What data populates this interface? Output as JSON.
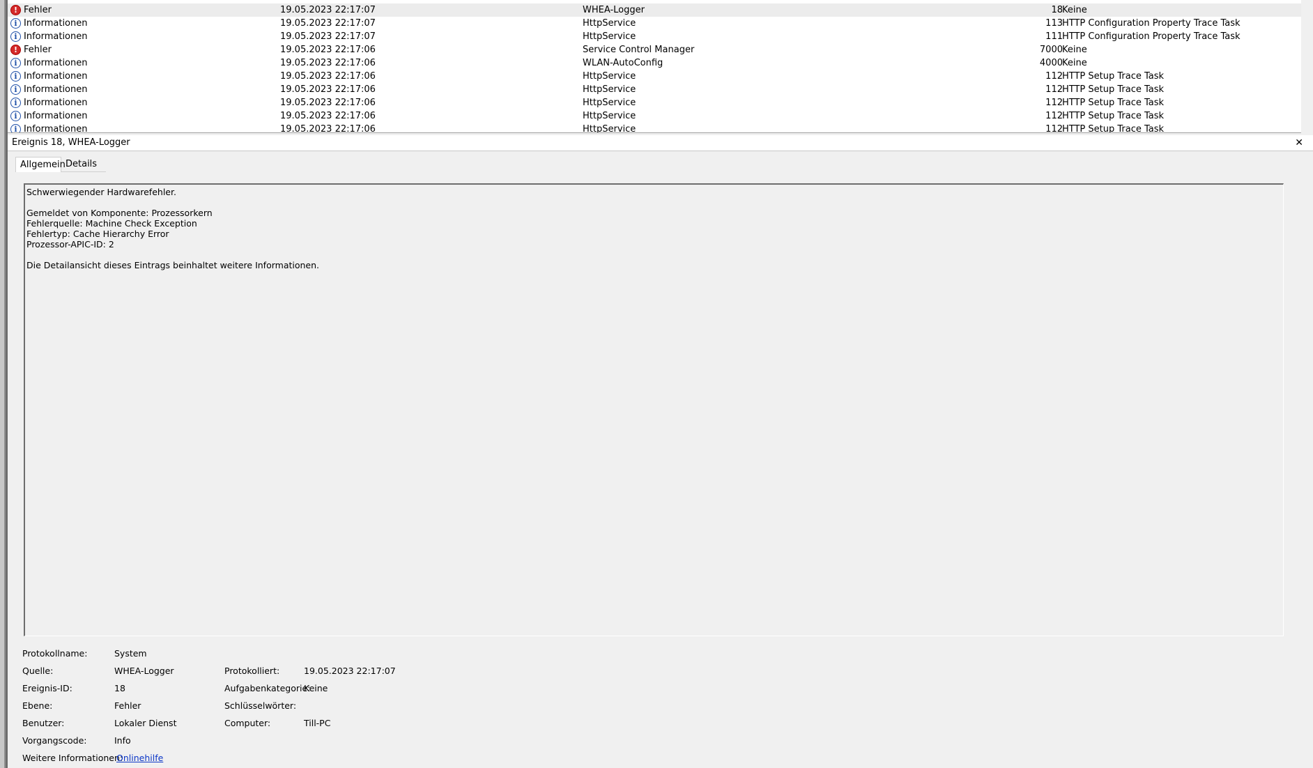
{
  "event_list": {
    "rows": [
      {
        "level": "Fehler",
        "type": "error",
        "date": "19.05.2023 22:17:07",
        "source": "WHEA-Logger",
        "id": "18",
        "category": "Keine",
        "selected": true
      },
      {
        "level": "Informationen",
        "type": "info",
        "date": "19.05.2023 22:17:07",
        "source": "HttpService",
        "id": "113",
        "category": "HTTP Configuration Property Trace Task"
      },
      {
        "level": "Informationen",
        "type": "info",
        "date": "19.05.2023 22:17:07",
        "source": "HttpService",
        "id": "111",
        "category": "HTTP Configuration Property Trace Task"
      },
      {
        "level": "Fehler",
        "type": "error",
        "date": "19.05.2023 22:17:06",
        "source": "Service Control Manager",
        "id": "7000",
        "category": "Keine"
      },
      {
        "level": "Informationen",
        "type": "info",
        "date": "19.05.2023 22:17:06",
        "source": "WLAN-AutoConfig",
        "id": "4000",
        "category": "Keine"
      },
      {
        "level": "Informationen",
        "type": "info",
        "date": "19.05.2023 22:17:06",
        "source": "HttpService",
        "id": "112",
        "category": "HTTP Setup Trace Task"
      },
      {
        "level": "Informationen",
        "type": "info",
        "date": "19.05.2023 22:17:06",
        "source": "HttpService",
        "id": "112",
        "category": "HTTP Setup Trace Task"
      },
      {
        "level": "Informationen",
        "type": "info",
        "date": "19.05.2023 22:17:06",
        "source": "HttpService",
        "id": "112",
        "category": "HTTP Setup Trace Task"
      },
      {
        "level": "Informationen",
        "type": "info",
        "date": "19.05.2023 22:17:06",
        "source": "HttpService",
        "id": "112",
        "category": "HTTP Setup Trace Task"
      },
      {
        "level": "Informationen",
        "type": "info",
        "date": "19.05.2023 22:17:06",
        "source": "HttpService",
        "id": "112",
        "category": "HTTP Setup Trace Task"
      }
    ]
  },
  "detail": {
    "title": "Ereignis 18, WHEA-Logger",
    "close_glyph": "✕",
    "tabs": [
      "Allgemein",
      "Details"
    ],
    "description_lines": [
      "Schwerwiegender Hardwarefehler.",
      "",
      "Gemeldet von Komponente: Prozessorkern",
      "Fehlerquelle: Machine Check Exception",
      "Fehlertyp: Cache Hierarchy Error",
      "Prozessor-APIC-ID: 2",
      "",
      "Die Detailansicht dieses Eintrags beinhaltet weitere Informationen."
    ],
    "properties": {
      "protokollname_label": "Protokollname:",
      "protokollname": "System",
      "quelle_label": "Quelle:",
      "quelle": "WHEA-Logger",
      "protokolliert_label": "Protokolliert:",
      "protokolliert": "19.05.2023 22:17:07",
      "ereignis_id_label": "Ereignis-ID:",
      "ereignis_id": "18",
      "aufgabenkategorie_label": "Aufgabenkategorie:",
      "aufgabenkategorie": "Keine",
      "ebene_label": "Ebene:",
      "ebene": "Fehler",
      "schluesselwoerter_label": "Schlüsselwörter:",
      "schluesselwoerter": "",
      "benutzer_label": "Benutzer:",
      "benutzer": "Lokaler Dienst",
      "computer_label": "Computer:",
      "computer": "Till-PC",
      "vorgangscode_label": "Vorgangscode:",
      "vorgangscode": "Info",
      "weitere_label": "Weitere Informationen:",
      "weitere_link": "Onlinehilfe"
    }
  },
  "icons": {
    "error_glyph": "!",
    "info_glyph": "i"
  }
}
